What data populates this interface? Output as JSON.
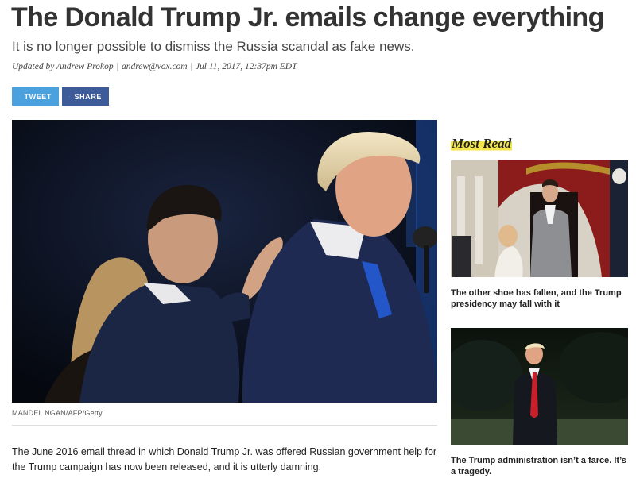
{
  "article": {
    "headline": "The Donald Trump Jr. emails change everything",
    "dek": "It is no longer possible to dismiss the Russia scandal as fake news.",
    "byline": {
      "updated_by": "Updated by Andrew Prokop",
      "email": "andrew@vox.com",
      "date": "Jul 11, 2017, 12:37pm EDT"
    },
    "share": {
      "tweet_label": "TWEET",
      "share_label": "SHARE"
    },
    "image_credit": "MANDEL NGAN/AFP/Getty",
    "body": "The June 2016 email thread in which Donald Trump Jr. was offered Russian government help for the Trump campaign has now been released, and it is utterly damning."
  },
  "most_read": {
    "title": "Most Read",
    "items": [
      {
        "title": "The other shoe has fallen, and the Trump presidency may fall with it"
      },
      {
        "title": "The Trump administration isn’t a farce. It’s a tragedy."
      }
    ]
  },
  "colors": {
    "tweet": "#4aa1de",
    "facebook": "#3e5b99",
    "most_read_highlight": "#f2e64a"
  }
}
